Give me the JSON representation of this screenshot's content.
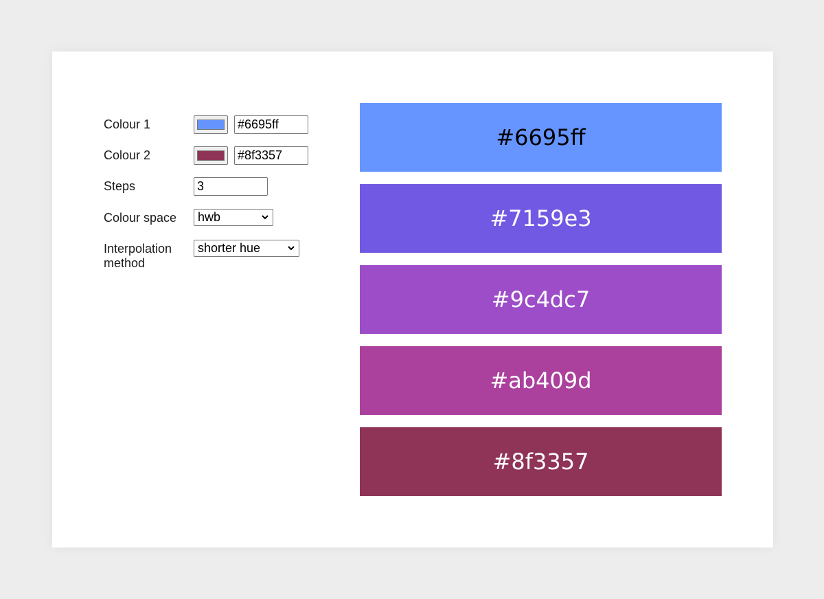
{
  "form": {
    "colour1": {
      "label": "Colour 1",
      "value": "#6695ff",
      "swatch_color": "#6695ff"
    },
    "colour2": {
      "label": "Colour 2",
      "value": "#8f3357",
      "swatch_color": "#8f3357"
    },
    "steps": {
      "label": "Steps",
      "value": "3"
    },
    "colour_space": {
      "label": "Colour space",
      "value": "hwb"
    },
    "interpolation": {
      "label": "Interpolation method",
      "value": "shorter hue"
    }
  },
  "swatches": [
    {
      "hex": "#6695ff",
      "text_color": "#000000"
    },
    {
      "hex": "#7159e3",
      "text_color": "#ffffff"
    },
    {
      "hex": "#9c4dc7",
      "text_color": "#ffffff"
    },
    {
      "hex": "#ab409d",
      "text_color": "#ffffff"
    },
    {
      "hex": "#8f3357",
      "text_color": "#ffffff"
    }
  ],
  "colors": {
    "page_background": "#ededed",
    "card_background": "#ffffff"
  }
}
